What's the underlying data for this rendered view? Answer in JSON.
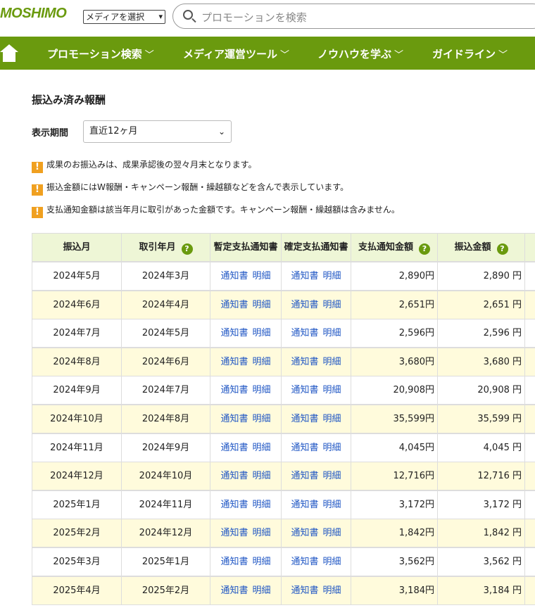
{
  "header": {
    "logo": "MOSHIMO",
    "media_select": "メディアを選択",
    "search_placeholder": "プロモーションを検索"
  },
  "nav": {
    "items": [
      {
        "label": "プロモーション検索"
      },
      {
        "label": "メディア運営ツール"
      },
      {
        "label": "ノウハウを学ぶ"
      },
      {
        "label": "ガイドライン"
      }
    ]
  },
  "page": {
    "title": "振込み済み報酬",
    "period_label": "表示期間",
    "period_value": "直近12ヶ月"
  },
  "notices": [
    "成果のお振込みは、成果承認後の翌々月末となります。",
    "振込金額にはW報酬・キャンペーン報酬・繰越額などを含んで表示しています。",
    "支払通知金額は該当年月に取引があった金額です。キャンペーン報酬・繰越額は含みません。"
  ],
  "table": {
    "headers": {
      "pay_month": "振込月",
      "trade_month": "取引年月",
      "provisional": "暫定支払通知書",
      "confirmed": "確定支払通知書",
      "notice_amount": "支払通知金額",
      "transfer_amount": "振込金額"
    },
    "link_notice": "通知書",
    "link_detail": "明細",
    "rows": [
      {
        "pay_month": "2024年5月",
        "trade_month": "2024年3月",
        "notice_amount": "2,890円",
        "transfer_amount": "2,890 円"
      },
      {
        "pay_month": "2024年6月",
        "trade_month": "2024年4月",
        "notice_amount": "2,651円",
        "transfer_amount": "2,651 円"
      },
      {
        "pay_month": "2024年7月",
        "trade_month": "2024年5月",
        "notice_amount": "2,596円",
        "transfer_amount": "2,596 円"
      },
      {
        "pay_month": "2024年8月",
        "trade_month": "2024年6月",
        "notice_amount": "3,680円",
        "transfer_amount": "3,680 円"
      },
      {
        "pay_month": "2024年9月",
        "trade_month": "2024年7月",
        "notice_amount": "20,908円",
        "transfer_amount": "20,908 円"
      },
      {
        "pay_month": "2024年10月",
        "trade_month": "2024年8月",
        "notice_amount": "35,599円",
        "transfer_amount": "35,599 円"
      },
      {
        "pay_month": "2024年11月",
        "trade_month": "2024年9月",
        "notice_amount": "4,045円",
        "transfer_amount": "4,045 円"
      },
      {
        "pay_month": "2024年12月",
        "trade_month": "2024年10月",
        "notice_amount": "12,716円",
        "transfer_amount": "12,716 円"
      },
      {
        "pay_month": "2025年1月",
        "trade_month": "2024年11月",
        "notice_amount": "3,172円",
        "transfer_amount": "3,172 円"
      },
      {
        "pay_month": "2025年2月",
        "trade_month": "2024年12月",
        "notice_amount": "1,842円",
        "transfer_amount": "1,842 円"
      },
      {
        "pay_month": "2025年3月",
        "trade_month": "2025年1月",
        "notice_amount": "3,562円",
        "transfer_amount": "3,562 円"
      },
      {
        "pay_month": "2025年4月",
        "trade_month": "2025年2月",
        "notice_amount": "3,184円",
        "transfer_amount": "3,184 円"
      }
    ]
  },
  "colors": {
    "brand_green": "#6a9a0e",
    "header_row_bg": "#eef6d6",
    "alt_row_bg": "#fffbdc",
    "link_blue": "#1f56c4",
    "notice_orange": "#f0a020"
  },
  "icons": [
    "search-icon",
    "home-icon",
    "chevron-down-icon",
    "help-icon",
    "warning-icon"
  ]
}
